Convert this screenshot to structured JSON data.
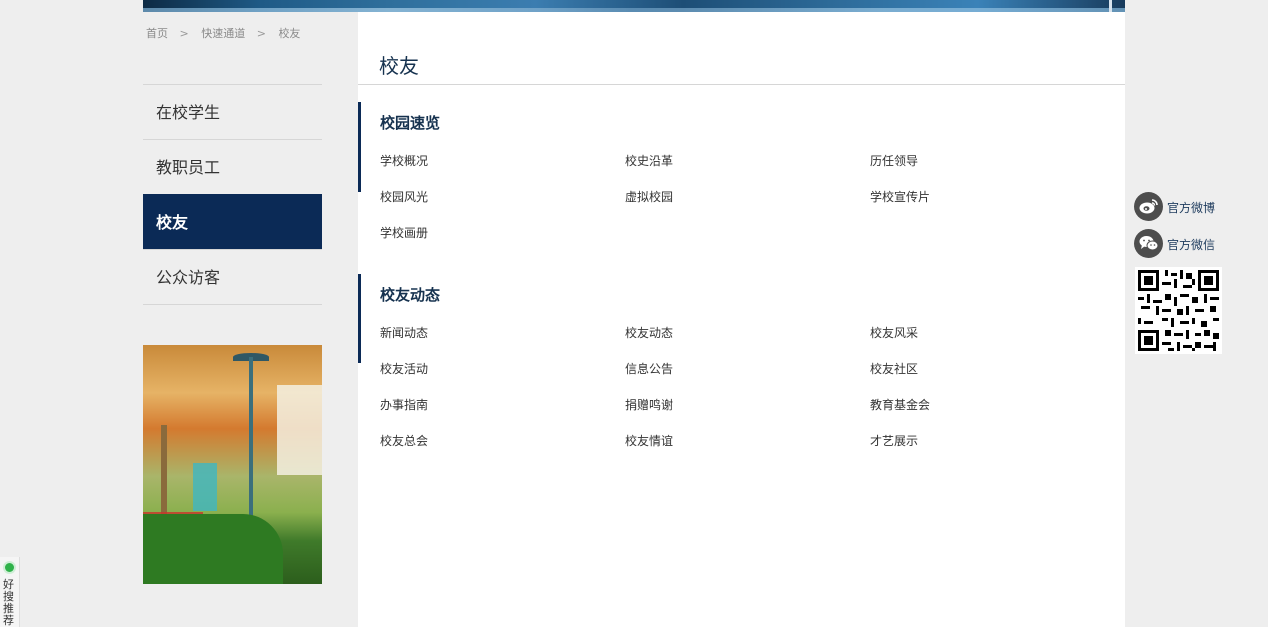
{
  "breadcrumb": {
    "home": "首页",
    "sep1": ">",
    "channel": "快速通道",
    "sep2": ">",
    "current": "校友"
  },
  "left_nav": {
    "items": [
      {
        "label": "在校学生"
      },
      {
        "label": "教职员工"
      },
      {
        "label": "校友",
        "active": true
      },
      {
        "label": "公众访客"
      }
    ],
    "active_color": "#0b2a56"
  },
  "main": {
    "title": "校友",
    "sections": [
      {
        "heading": "校园速览",
        "links": [
          "学校概况",
          "校史沿革",
          "历任领导",
          "校园风光",
          "虚拟校园",
          "学校宣传片",
          "学校画册"
        ]
      },
      {
        "heading": "校友动态",
        "links": [
          "新闻动态",
          "校友动态",
          "校友风采",
          "校友活动",
          "信息公告",
          "校友社区",
          "办事指南",
          "捐赠鸣谢",
          "教育基金会",
          "校友总会",
          "校友情谊",
          "才艺展示"
        ]
      }
    ]
  },
  "social": {
    "weibo": {
      "label": "官方微博",
      "icon": "weibo-icon"
    },
    "wechat": {
      "label": "官方微信",
      "icon": "wechat-icon"
    },
    "qr_icon": "qr-code"
  },
  "widget": {
    "text": "好搜推荐"
  }
}
